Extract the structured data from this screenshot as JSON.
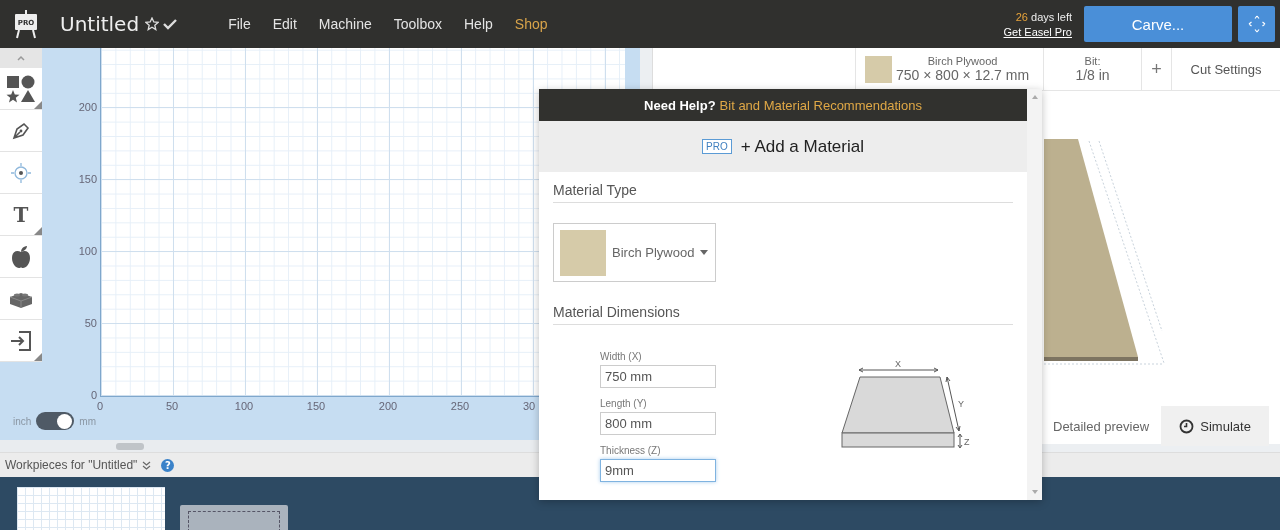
{
  "app_bar": {
    "logo_badge": "PRO",
    "title": "Untitled",
    "menu": [
      {
        "label": "File",
        "kind": "menu"
      },
      {
        "label": "Edit",
        "kind": "menu"
      },
      {
        "label": "Machine",
        "kind": "menu"
      },
      {
        "label": "Toolbox",
        "kind": "menu"
      },
      {
        "label": "Help",
        "kind": "menu"
      },
      {
        "label": "Shop",
        "kind": "shop"
      }
    ],
    "trial_days": "26",
    "trial_suffix": "days left",
    "upgrade_link": "Get Easel Pro",
    "carve_button": "Carve..."
  },
  "tools": [
    {
      "kind": "shapes",
      "submenu": true
    },
    {
      "kind": "pen",
      "submenu": false
    },
    {
      "kind": "point",
      "submenu": false
    },
    {
      "kind": "text",
      "glyph": "T",
      "submenu": true
    },
    {
      "kind": "apple",
      "submenu": false
    },
    {
      "kind": "brick",
      "submenu": false
    },
    {
      "kind": "import",
      "submenu": true
    }
  ],
  "canvas": {
    "y_ticks": [
      "200",
      "150",
      "100",
      "50",
      "0"
    ],
    "x_ticks": [
      "0",
      "50",
      "100",
      "150",
      "200",
      "250",
      "30"
    ],
    "unit_toggle": {
      "left": "inch",
      "right": "mm",
      "on": true
    }
  },
  "material_bar": {
    "name": "Birch Plywood",
    "dimensions": "750 × 800 × 12.7 mm",
    "bit_label": "Bit:",
    "bit": "1/8 in",
    "add": "+",
    "cut_settings": "Cut Settings"
  },
  "preview": {
    "detailed_preview": "Detailed preview",
    "simulate": "Simulate"
  },
  "workpieces": {
    "label": "Workpieces for \"Untitled\"",
    "help": "?",
    "items": [
      {
        "kind": "canvas"
      },
      {
        "kind": "sheet"
      }
    ]
  },
  "modal": {
    "help_prefix": "Need Help?",
    "help_link": "Bit and Material Recommendations",
    "badge": "PRO",
    "title": "+ Add a Material",
    "type_heading": "Material Type",
    "material": "Birch Plywood",
    "dimensions_heading": "Material Dimensions",
    "fields": [
      {
        "label": "Width (X)",
        "value": "750 mm",
        "focused": false
      },
      {
        "label": "Length (Y)",
        "value": "800 mm",
        "focused": false
      },
      {
        "label": "Thickness (Z)",
        "value": "9mm",
        "focused": true
      }
    ],
    "diagram_labels": [
      "X",
      "Y",
      "Z"
    ]
  }
}
